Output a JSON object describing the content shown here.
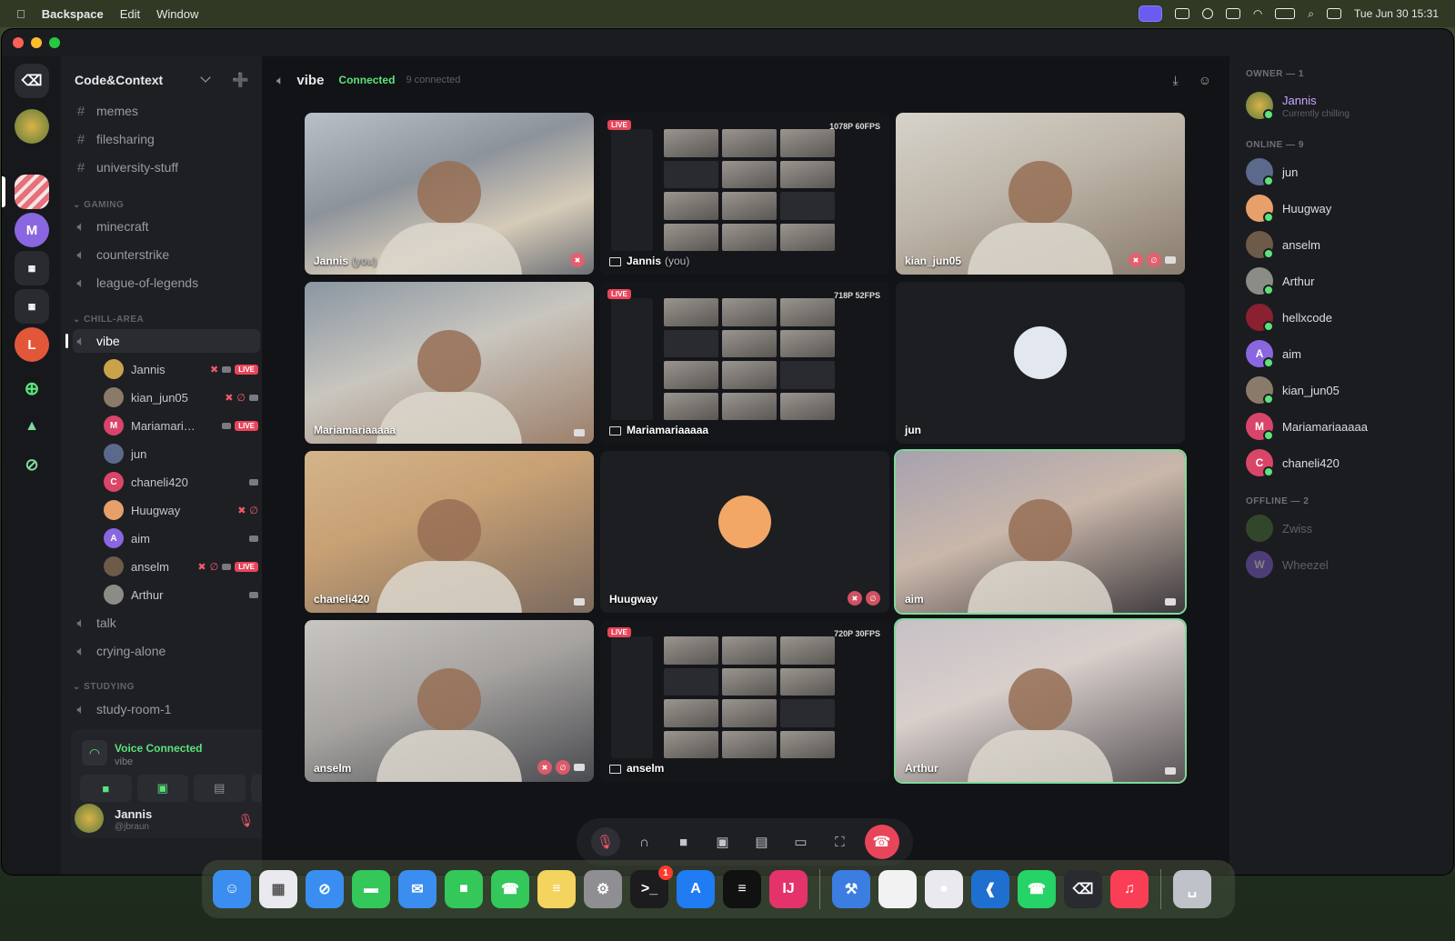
{
  "menubar": {
    "app_name": "Backspace",
    "menus": [
      "Edit",
      "Window"
    ],
    "clock": "Tue Jun 30  15:31"
  },
  "server": {
    "name": "Code&Context",
    "rail_letters": [
      "M",
      "L"
    ]
  },
  "channels": {
    "text_top": [
      "memes",
      "filesharing",
      "university-stuff"
    ],
    "gaming_label": "GAMING",
    "gaming": [
      "minecraft",
      "counterstrike",
      "league-of-legends"
    ],
    "chill_label": "CHILL-AREA",
    "active": "vibe",
    "chill_after": [
      "talk",
      "crying-alone"
    ],
    "studying_label": "STUDYING",
    "studying": [
      "study-room-1"
    ]
  },
  "voice_users": [
    {
      "name": "Jannis",
      "muted": true,
      "cam": true,
      "live": true,
      "color": "#c9a24a",
      "initial": ""
    },
    {
      "name": "kian_jun05",
      "muted": true,
      "deaf": true,
      "cam": true,
      "live": false,
      "color": "#8a7a6a",
      "initial": ""
    },
    {
      "name": "Mariamariaa...",
      "cam": true,
      "live": true,
      "color": "#d9446a",
      "initial": "M"
    },
    {
      "name": "jun",
      "color": "#5b6a8c",
      "initial": ""
    },
    {
      "name": "chaneli420",
      "cam": true,
      "color": "#d94668",
      "initial": "C"
    },
    {
      "name": "Huugway",
      "muted": true,
      "deaf": true,
      "color": "#e7a06a",
      "initial": ""
    },
    {
      "name": "aim",
      "cam": true,
      "color": "#8a66e0",
      "initial": "A"
    },
    {
      "name": "anselm",
      "muted": true,
      "deaf": true,
      "cam": true,
      "live": true,
      "color": "#6d5a48",
      "initial": ""
    },
    {
      "name": "Arthur",
      "cam": true,
      "color": "#8c8c86",
      "initial": ""
    }
  ],
  "live_label": "LIVE",
  "voice_panel": {
    "status": "Voice Connected",
    "channel": "vibe"
  },
  "current_user": {
    "name": "Jannis",
    "handle": "@jbraun"
  },
  "topbar": {
    "channel": "vibe",
    "status": "Connected",
    "count": "9 connected"
  },
  "tiles": [
    {
      "label": "Jannis",
      "you": "(you)"
    },
    {
      "label": "Jannis",
      "you": "(you)",
      "fps": "1078P 60FPS"
    },
    {
      "label": "kian_jun05"
    },
    {
      "label": "Mariamariaaaaa"
    },
    {
      "label": "Mariamariaaaaa",
      "fps": "718P 52FPS"
    },
    {
      "label": "jun"
    },
    {
      "label": "chaneli420"
    },
    {
      "label": "Huugway"
    },
    {
      "label": "aim"
    },
    {
      "label": "anselm"
    },
    {
      "label": "anselm",
      "fps": "720P 30FPS"
    },
    {
      "label": "Arthur"
    }
  ],
  "members": {
    "owner_label": "OWNER — 1",
    "owner": {
      "name": "Jannis",
      "status": "Currently chilling"
    },
    "online_label": "ONLINE — 9",
    "online": [
      {
        "name": "jun",
        "color": "#5b6a8c",
        "initial": ""
      },
      {
        "name": "Huugway",
        "color": "#e7a06a",
        "initial": ""
      },
      {
        "name": "anselm",
        "color": "#6d5a48",
        "initial": ""
      },
      {
        "name": "Arthur",
        "color": "#8c8c86",
        "initial": ""
      },
      {
        "name": "hellxcode",
        "color": "#8a2030",
        "initial": ""
      },
      {
        "name": "aim",
        "color": "#8a66e0",
        "initial": "A"
      },
      {
        "name": "kian_jun05",
        "color": "#8a7a6a",
        "initial": ""
      },
      {
        "name": "Mariamariaaaaa",
        "color": "#d9446a",
        "initial": "M"
      },
      {
        "name": "chaneli420",
        "color": "#d94668",
        "initial": "C"
      }
    ],
    "offline_label": "OFFLINE — 2",
    "offline": [
      {
        "name": "Zwiss",
        "color": "#4f7a3a",
        "initial": ""
      },
      {
        "name": "Wheezel",
        "color": "#8a66e0",
        "initial": "W"
      }
    ]
  },
  "dock": {
    "terminal_badge": "1",
    "apps": [
      "finder-icon",
      "launchpad-icon",
      "safari-icon",
      "messages-icon",
      "mail-icon",
      "facetime-icon",
      "phone-icon",
      "notes-icon",
      "settings-icon",
      "terminal-icon",
      "appstore-icon",
      "spotify-icon",
      "intellij-icon",
      "xcode-icon",
      "textedit-icon",
      "chrome-icon",
      "vscode-icon",
      "whatsapp-icon",
      "backspace-icon",
      "music-icon",
      "trash-icon"
    ]
  }
}
